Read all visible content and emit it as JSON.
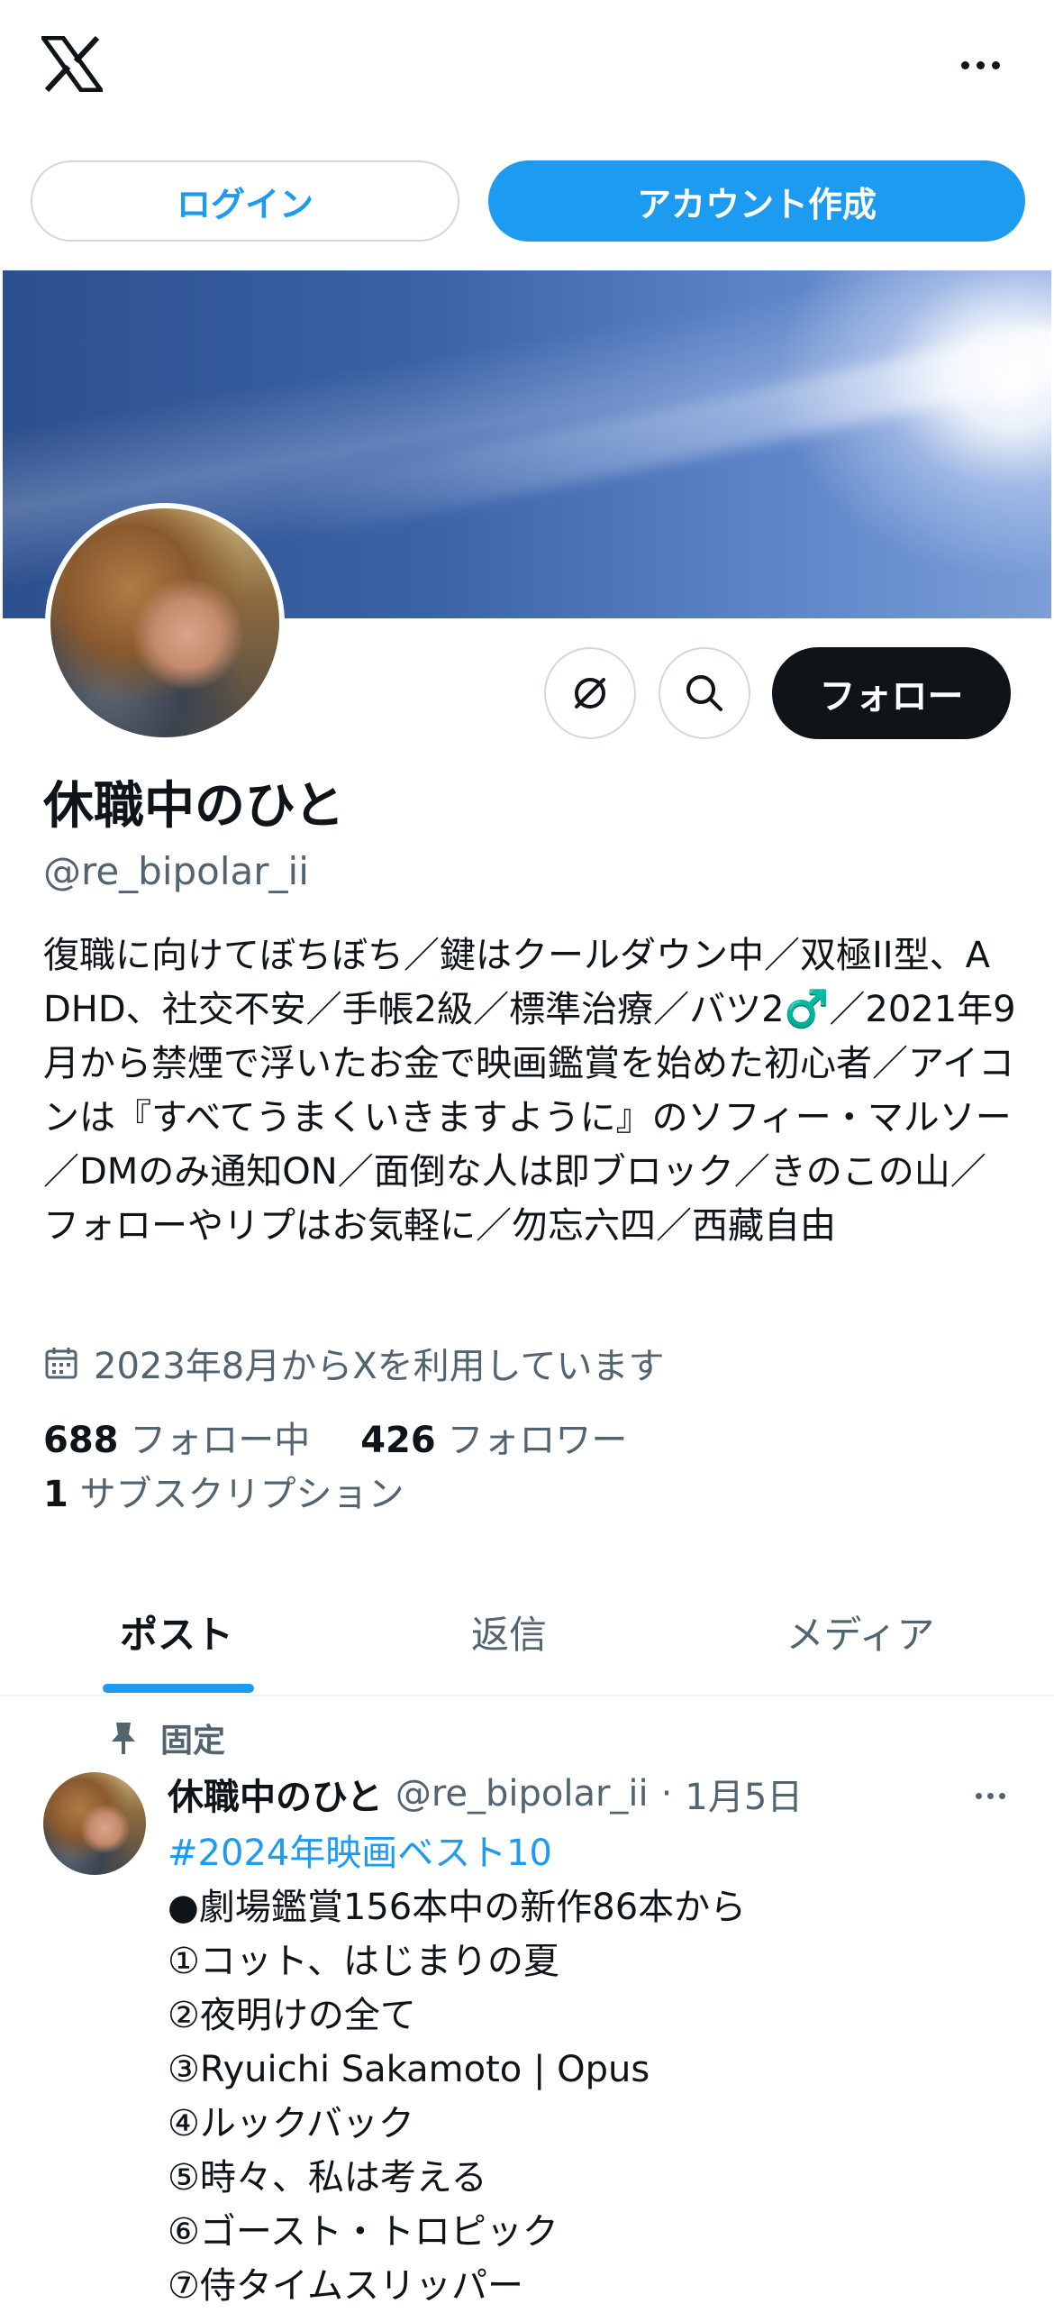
{
  "header": {
    "logo_icon": "x-logo-icon",
    "more_icon": "more-horizontal-icon"
  },
  "auth": {
    "login_label": "ログイン",
    "signup_label": "アカウント作成"
  },
  "profile": {
    "display_name": "休職中のひと",
    "handle": "@re_bipolar_ii",
    "bio": "復職に向けてぼちぼち／鍵はクールダウン中／双極II型、ADHD、社交不安／手帳2級／標準治療／バツ2♂️／2021年9月から禁煙で浮いたお金で映画鑑賞を始めた初心者／アイコンは『すべてうまくいきますように』のソフィー・マルソー／DMのみ通知ON／面倒な人は即ブロック／きのこの山／フォローやリプはお気軽に／勿忘六四／西藏自由",
    "joined": "2023年8月からXを利用しています",
    "following_count": "688",
    "following_label": "フォロー中",
    "followers_count": "426",
    "followers_label": "フォロワー",
    "subscriptions_count": "1",
    "subscriptions_label": "サブスクリプション"
  },
  "actions": {
    "grok_icon": "grok-icon",
    "search_icon": "search-icon",
    "follow_label": "フォロー"
  },
  "tabs": [
    {
      "label": "ポスト",
      "active": true
    },
    {
      "label": "返信",
      "active": false
    },
    {
      "label": "メディア",
      "active": false
    }
  ],
  "pinned_post": {
    "pinned_label": "固定",
    "author_name": "休職中のひと",
    "author_handle": "@re_bipolar_ii",
    "separator": "·",
    "date": "1月5日",
    "hashtag": "#2024年映画ベスト10",
    "lines": [
      "●劇場鑑賞156本中の新作86本から",
      "①コット、はじまりの夏",
      "②夜明けの全て",
      "③Ryuichi Sakamoto | Opus",
      "④ルックバック",
      "⑤時々、私は考える",
      "⑥ゴースト・トロピック",
      "⑦侍タイムスリッパー"
    ]
  },
  "colors": {
    "accent": "#1d9bf0",
    "text_primary": "#0f1419",
    "text_secondary": "#536471",
    "border": "#cfd9de"
  }
}
